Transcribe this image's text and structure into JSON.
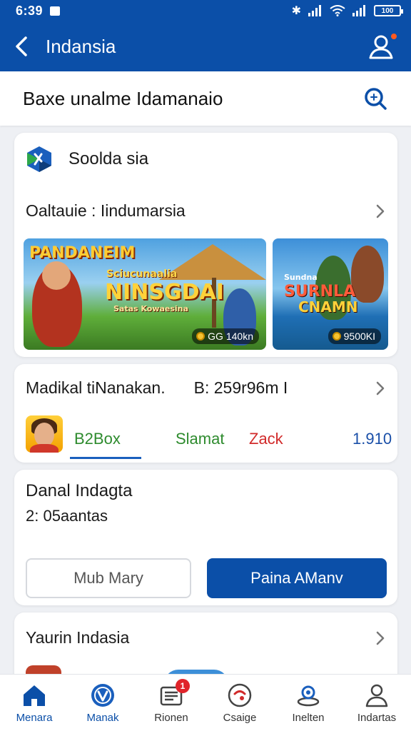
{
  "status_bar": {
    "time": "6:39",
    "battery": "100"
  },
  "app_bar": {
    "title": "Indansia"
  },
  "search": {
    "label": "Baxe unalme Idamanaio"
  },
  "card_game": {
    "brand": "Soolda sia",
    "section_title": "Oaltauie : Iindumarsia",
    "banners": [
      {
        "headline": "PANDANEIM",
        "small": "Sciucunaalia",
        "main": "NINSGDAI",
        "caption": "Satas Kowaesina",
        "price": "GG 140kn"
      },
      {
        "small": "Sundna",
        "main": "SURNLA",
        "main2": "CNAMN",
        "price": "9500KI"
      }
    ]
  },
  "card_medical": {
    "title": "Madikal tiNanakan.",
    "value": "B: 259r96m I",
    "tabs": [
      "B2Box",
      "Slamat",
      "Zack",
      "1.910"
    ]
  },
  "card_info": {
    "title": "Danal Indagta",
    "subtitle": "2: 05aantas",
    "button_secondary": "Mub Mary",
    "button_primary": "Paina AManv"
  },
  "card_bottom": {
    "title": "Yaurin Indasia"
  },
  "bottom_nav": {
    "items": [
      {
        "label": "Menara",
        "icon": "home-icon"
      },
      {
        "label": "Manak",
        "icon": "compass-icon"
      },
      {
        "label": "Rionen",
        "icon": "news-icon",
        "badge": "1"
      },
      {
        "label": "Csaige",
        "icon": "chat-icon"
      },
      {
        "label": "Inelten",
        "icon": "location-icon"
      },
      {
        "label": "Indartas",
        "icon": "profile-icon"
      }
    ]
  },
  "colors": {
    "primary": "#0b4fa8",
    "accent": "#ff5a1f",
    "green": "#2e8b2e",
    "red": "#d12a2a"
  }
}
